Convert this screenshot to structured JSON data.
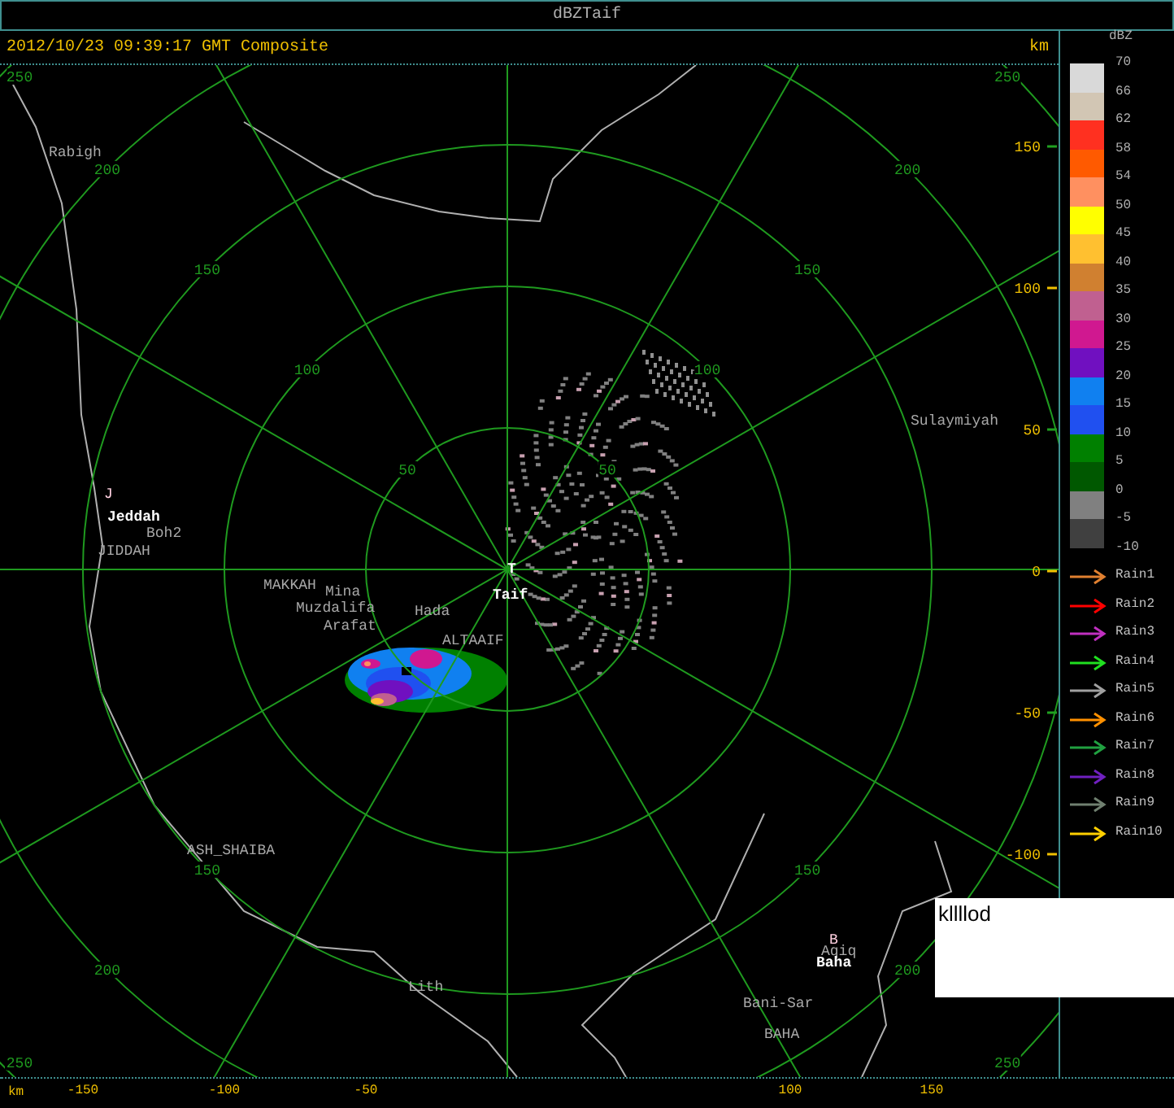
{
  "window": {
    "title": "dBZTaif"
  },
  "header": {
    "timestamp": "2012/10/23 09:39:17 GMT Composite",
    "unit": "km"
  },
  "map": {
    "ring_labels": [
      {
        "label": "250"
      },
      {
        "label": "250"
      },
      {
        "label": "200"
      },
      {
        "label": "200"
      },
      {
        "label": "150"
      },
      {
        "label": "150"
      },
      {
        "label": "100"
      },
      {
        "label": "100"
      },
      {
        "label": "50"
      },
      {
        "label": "50"
      },
      {
        "label": "150"
      },
      {
        "label": "150"
      },
      {
        "label": "200"
      },
      {
        "label": "200"
      },
      {
        "label": "250"
      },
      {
        "label": "250"
      }
    ],
    "places": [
      {
        "name": "Rabigh",
        "kind": "secondary"
      },
      {
        "name": "J",
        "kind": "marker"
      },
      {
        "name": "Jeddah",
        "kind": "primary"
      },
      {
        "name": "Boh2",
        "kind": "secondary"
      },
      {
        "name": "JIDDAH",
        "kind": "secondary"
      },
      {
        "name": "MAKKAH",
        "kind": "secondary"
      },
      {
        "name": "Mina",
        "kind": "secondary"
      },
      {
        "name": "Muzdalifa",
        "kind": "secondary"
      },
      {
        "name": "Arafat",
        "kind": "secondary"
      },
      {
        "name": "Hada",
        "kind": "secondary"
      },
      {
        "name": "T",
        "kind": "primary"
      },
      {
        "name": "Taif",
        "kind": "primary"
      },
      {
        "name": "ALTAAIF",
        "kind": "secondary"
      },
      {
        "name": "Sulaymiyah",
        "kind": "secondary"
      },
      {
        "name": "ASH_SHAIBA",
        "kind": "secondary"
      },
      {
        "name": "Lith",
        "kind": "secondary"
      },
      {
        "name": "B",
        "kind": "marker"
      },
      {
        "name": "Aqiq",
        "kind": "secondary"
      },
      {
        "name": "Baha",
        "kind": "primary"
      },
      {
        "name": "Bani-Sar",
        "kind": "secondary"
      },
      {
        "name": "BAHA",
        "kind": "secondary"
      }
    ],
    "y_axis": {
      "labels": [
        "150",
        "100",
        "50",
        "0",
        "-50",
        "-100"
      ]
    },
    "x_axis": {
      "unit": "km",
      "labels": [
        "-150",
        "-100",
        "-50",
        "100",
        "150"
      ]
    }
  },
  "legend": {
    "title": "dBZ",
    "bins": [
      {
        "color": "#d9d9d9"
      },
      {
        "color": "#d2c6b4"
      },
      {
        "color": "#ff3020"
      },
      {
        "color": "#ff5a00"
      },
      {
        "color": "#ff9060"
      },
      {
        "color": "#ffff00"
      },
      {
        "color": "#ffc030"
      },
      {
        "color": "#d08030"
      },
      {
        "color": "#c06090"
      },
      {
        "color": "#d01890"
      },
      {
        "color": "#7010c0"
      },
      {
        "color": "#1080f0"
      },
      {
        "color": "#2050f0"
      },
      {
        "color": "#008000"
      },
      {
        "color": "#005800"
      },
      {
        "color": "#808080"
      },
      {
        "color": "#404040"
      }
    ],
    "ticks": [
      "70",
      "66",
      "62",
      "58",
      "54",
      "50",
      "45",
      "40",
      "35",
      "30",
      "25",
      "20",
      "15",
      "10",
      "5",
      "0",
      "-5",
      "-10"
    ],
    "rain_tracks": [
      {
        "label": "Rain1",
        "color": "#e08030"
      },
      {
        "label": "Rain2",
        "color": "#ff0000"
      },
      {
        "label": "Rain3",
        "color": "#c030c0"
      },
      {
        "label": "Rain4",
        "color": "#20e020"
      },
      {
        "label": "Rain5",
        "color": "#a0a0a0"
      },
      {
        "label": "Rain6",
        "color": "#ff9000"
      },
      {
        "label": "Rain7",
        "color": "#20a040"
      },
      {
        "label": "Rain8",
        "color": "#7020c0"
      },
      {
        "label": "Rain9",
        "color": "#708070"
      },
      {
        "label": "Rain10",
        "color": "#ffd000"
      }
    ]
  },
  "overlay_box": {
    "text": "kllllod"
  }
}
